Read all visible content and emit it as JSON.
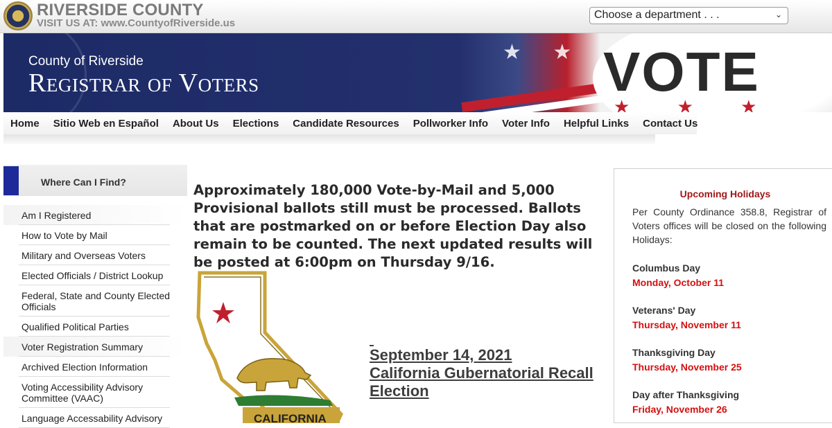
{
  "header": {
    "county_name": "RIVERSIDE COUNTY",
    "visit_text": "VISIT US AT: www.CountyofRiverside.us",
    "department_select": "Choose a department . . ."
  },
  "banner": {
    "subtitle": "County of Riverside",
    "title": "Registrar of Voters",
    "vote_text": "VOTE"
  },
  "nav": {
    "items": [
      "Home",
      "Sitio Web en Español",
      "About Us",
      "Elections",
      "Candidate Resources",
      "Pollworker Info",
      "Voter Info",
      "Helpful Links",
      "Contact Us"
    ]
  },
  "sidebar": {
    "heading": "Where Can I Find?",
    "items": [
      "Am I Registered",
      "How to Vote by Mail",
      "Military and Overseas Voters",
      "Elected Officials / District Lookup",
      "Federal, State and County Elected Officials",
      "Qualified Political Parties",
      "Voter Registration Summary",
      "Archived Election Information",
      "Voting Accessibility Advisory Committee (VAAC)",
      "Language Accessability Advisory"
    ]
  },
  "main": {
    "announcement": "Approximately 180,000 Vote-by-Mail and 5,000 Provisional ballots still must be processed. Ballots that are postmarked on or before Election Day also remain to be counted. The next updated results will be posted at 6:00pm on Thursday 9/16.",
    "map_label": "CALIFORNIA",
    "election_date": "September 14, 2021",
    "election_name": "California Gubernatorial Recall Election"
  },
  "holidays": {
    "title": "Upcoming Holidays",
    "intro": "Per County Ordinance 358.8, Registrar of Voters offices will be closed on the following Holidays:",
    "entries": [
      {
        "name": "Columbus Day",
        "date": "Monday, October 11"
      },
      {
        "name": "Veterans' Day",
        "date": "Thursday, November 11"
      },
      {
        "name": "Thanksgiving Day",
        "date": "Thursday, November 25"
      },
      {
        "name": "Day after Thanksgiving",
        "date": "Friday, November 26"
      }
    ]
  },
  "colors": {
    "navy": "#1c2a66",
    "holiday_red": "#d41010",
    "holiday_title": "#a01818"
  }
}
